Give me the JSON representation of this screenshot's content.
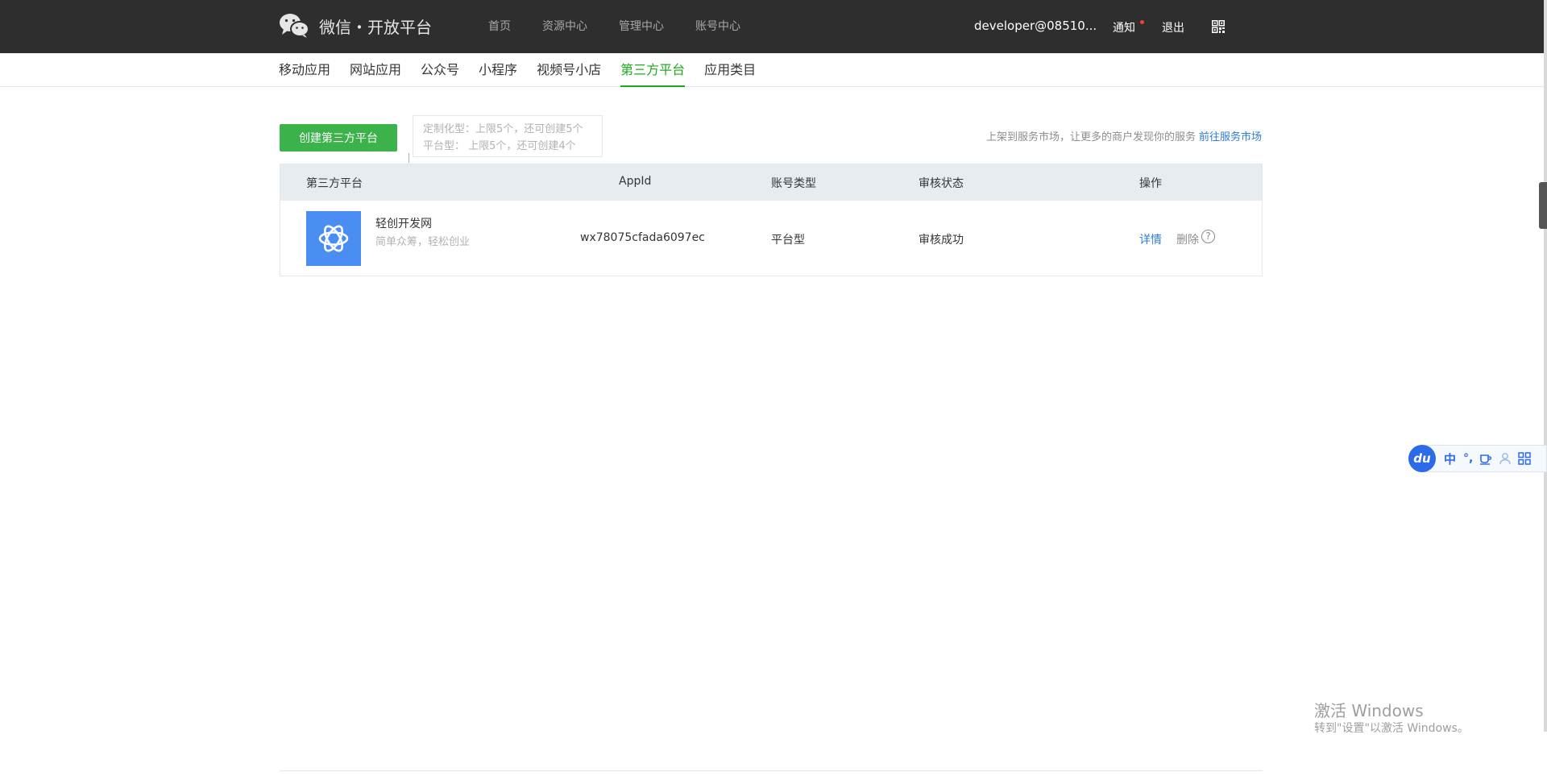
{
  "topbar": {
    "logo_text": "微信・开放平台",
    "nav": [
      {
        "label": "首页"
      },
      {
        "label": "资源中心"
      },
      {
        "label": "管理中心"
      },
      {
        "label": "账号中心"
      }
    ],
    "account": "developer@08510...",
    "notify": "通知",
    "logout": "退出"
  },
  "subnav": {
    "items": [
      {
        "label": "移动应用"
      },
      {
        "label": "网站应用"
      },
      {
        "label": "公众号"
      },
      {
        "label": "小程序"
      },
      {
        "label": "视频号小店"
      },
      {
        "label": "第三方平台"
      },
      {
        "label": "应用类目"
      }
    ],
    "active": "第三方平台"
  },
  "toolbar": {
    "create_label": "创建第三方平台",
    "quota_custom": "定制化型：上限5个，还可创建5个",
    "quota_platform": "平台型：  上限5个，还可创建4个",
    "market_hint": "上架到服务市场，让更多的商户发现你的服务",
    "market_link": "前往服务市场"
  },
  "table": {
    "headers": {
      "platform": "第三方平台",
      "appid": "AppId",
      "type": "账号类型",
      "status": "审核状态",
      "action": "操作"
    },
    "rows": [
      {
        "name": "轻创开发网",
        "desc": "简单众筹，轻松创业",
        "appid": "wx78075cfada6097ec",
        "type": "平台型",
        "status": "审核成功",
        "detail": "详情",
        "delete": "删除",
        "help": "?"
      }
    ]
  },
  "ime": {
    "logo": "du",
    "lang": "中",
    "punct": "°,"
  },
  "watermark": {
    "title": "激活 Windows",
    "subtitle": "转到\"设置\"以激活 Windows。"
  }
}
